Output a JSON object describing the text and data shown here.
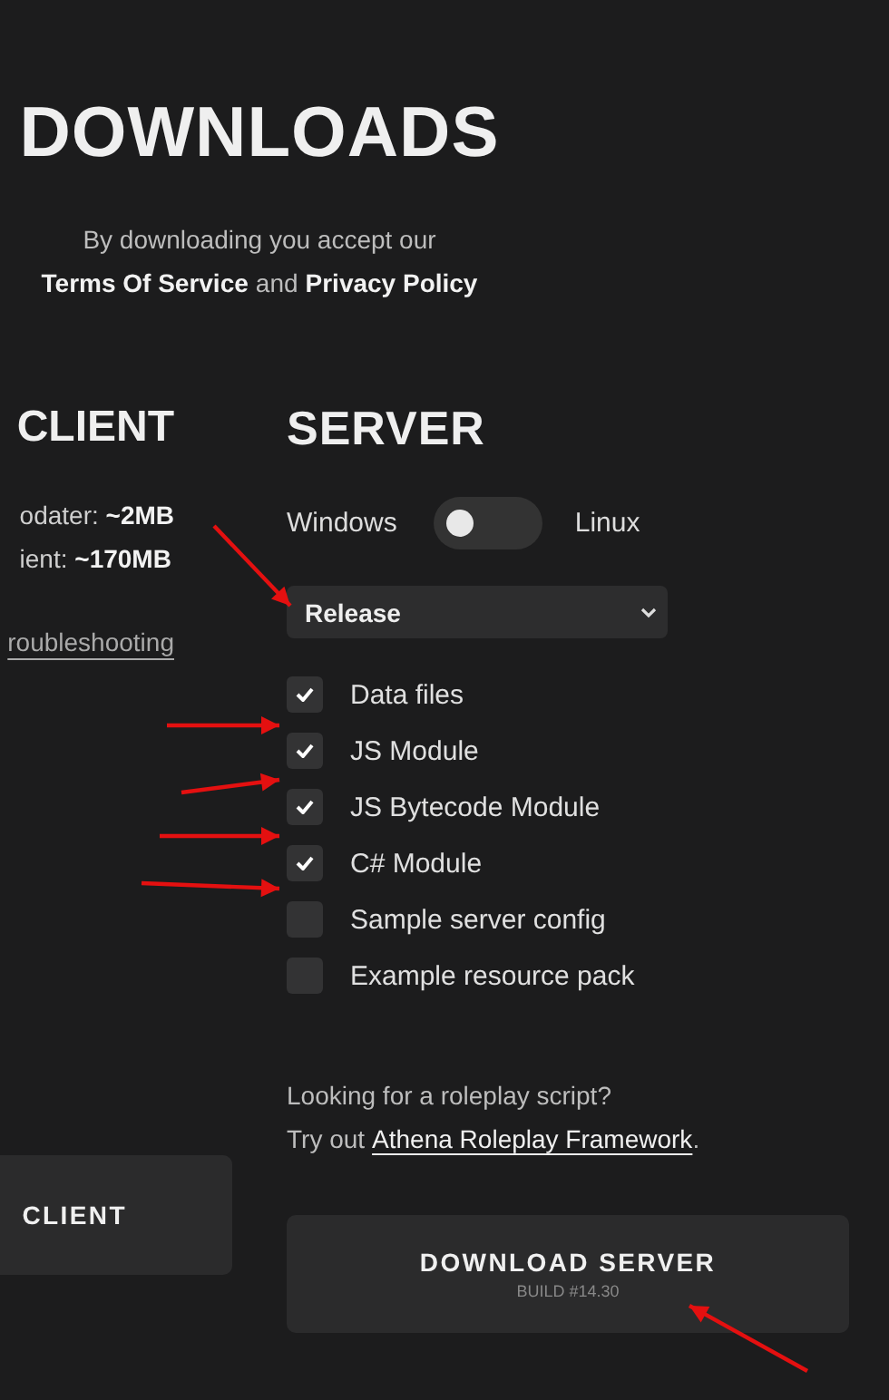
{
  "header": {
    "title": "DOWNLOADS",
    "notice": "By downloading you accept our",
    "terms_link": "Terms Of Service",
    "joiner": "and",
    "privacy_link": "Privacy Policy"
  },
  "client": {
    "title": "CLIENT",
    "sizes": [
      {
        "label": "odater:",
        "value": "~2MB"
      },
      {
        "label": "ient:",
        "value": "~170MB"
      }
    ],
    "help_link": "roubleshooting",
    "button": "CLIENT"
  },
  "server": {
    "title": "SERVER",
    "platform_left": "Windows",
    "platform_right": "Linux",
    "platform_toggle_on": false,
    "branch_select": {
      "value": "Release"
    },
    "options": [
      {
        "label": "Data files",
        "checked": true
      },
      {
        "label": "JS Module",
        "checked": true
      },
      {
        "label": "JS Bytecode Module",
        "checked": true
      },
      {
        "label": "C# Module",
        "checked": true
      },
      {
        "label": "Sample server config",
        "checked": false
      },
      {
        "label": "Example resource pack",
        "checked": false
      }
    ],
    "promo": "Looking for a roleplay script?",
    "promo_prefix": "Try out",
    "promo_link": "Athena Roleplay Framework",
    "promo_suffix": ".",
    "button": "DOWNLOAD SERVER",
    "build": "BUILD #14.30"
  }
}
